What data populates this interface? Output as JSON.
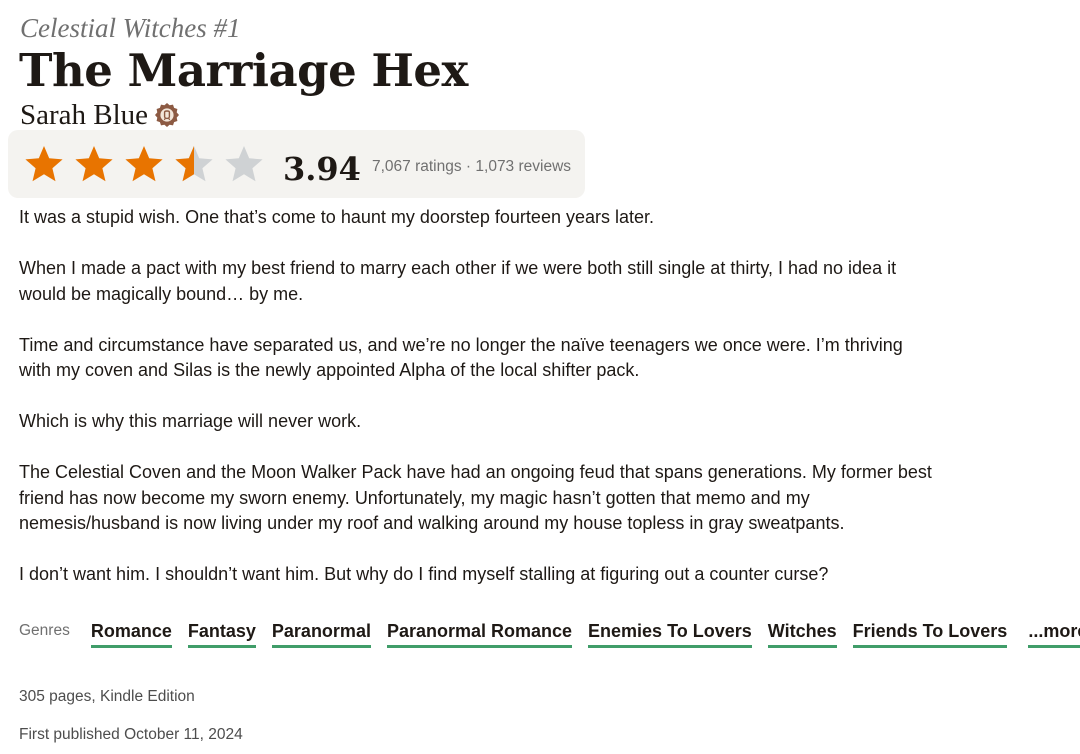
{
  "book": {
    "series": "Celestial Witches #1",
    "title": "The Marriage Hex",
    "author": "Sarah Blue",
    "author_badge_icon": "goodreads-author-badge-icon"
  },
  "rating": {
    "average": "3.94",
    "stars_filled": 3,
    "stars_partial": 1,
    "stars_empty": 1,
    "star_fill_color": "#e87400",
    "star_empty_color": "#cfd2d4",
    "counts_text": "7,067 ratings · 1,073 reviews"
  },
  "description": {
    "paragraphs": [
      "It was a stupid wish. One that’s come to haunt my doorstep fourteen years later.",
      "When I made a pact with my best friend to marry each other if we were both still single at thirty, I had no idea it\nwould be magically bound… by me.",
      "Time and circumstance have separated us, and we’re no longer the naïve teenagers we once were. I’m thriving\nwith my coven and Silas is the newly appointed Alpha of the local shifter pack.",
      "Which is why this marriage will never work.",
      "The Celestial Coven and the Moon Walker Pack have had an ongoing feud that spans generations. My former best\nfriend has now become my sworn enemy. Unfortunately, my magic hasn’t gotten that memo and my\nnemesis/husband is now living under my roof and walking around my house topless in gray sweatpants.",
      "I don’t want him. I shouldn’t want him. But why do I find myself stalling at figuring out a counter curse?"
    ]
  },
  "genres": {
    "label": "Genres",
    "items": [
      "Romance",
      "Fantasy",
      "Paranormal",
      "Paranormal Romance",
      "Enemies To Lovers",
      "Witches",
      "Friends To Lovers"
    ],
    "more_label": "...more",
    "underline_color": "#409d69"
  },
  "details": {
    "format": "305 pages, Kindle Edition",
    "published": "First published October 11, 2024"
  }
}
